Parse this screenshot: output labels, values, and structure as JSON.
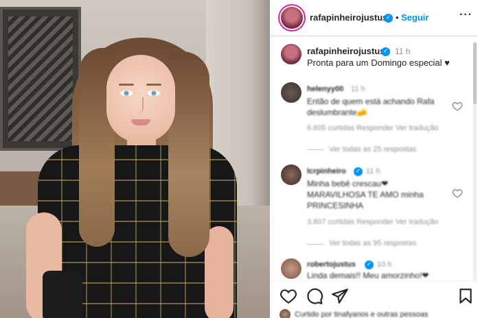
{
  "post": {
    "username": "rafapinheirojustus",
    "follow_label": "Seguir",
    "separator": "•",
    "more_label": "···",
    "caption": "Pronta para um Domingo especial ♥",
    "caption_time": "11 h"
  },
  "comments": [
    {
      "user": "helenyy00",
      "time": "11 h",
      "text_line1": "Então de quem está achando Rafa",
      "text_line2": "deslumbrante🧀",
      "meta": "6.605 curtidas    Responder    Ver tradução",
      "replies": "Ver todas as 25 respostas"
    },
    {
      "user": "lcrpinheiro",
      "time": "11 h",
      "text_line1": "Minha bebê crescau❤",
      "text_line2": "MARAVILHOSA TE AMO minha",
      "text_line3": "PRINCESINHA",
      "meta": "3.607 curtidas    Responder    Ver tradução",
      "replies": "Ver todas as 95 respostas"
    },
    {
      "user": "robertojustus",
      "time": "10 h",
      "text_line1": "Linda demais!! Meu amorzinho!❤"
    }
  ],
  "footer": {
    "likes_text": "Curtido por tinafyanos e outras pessoas"
  },
  "colors": {
    "accent": "#0095f6",
    "text": "#262626",
    "muted": "#8e8e8e"
  },
  "icons": [
    "heart-icon",
    "comment-icon",
    "share-icon",
    "save-icon",
    "more-icon",
    "verified-icon"
  ]
}
